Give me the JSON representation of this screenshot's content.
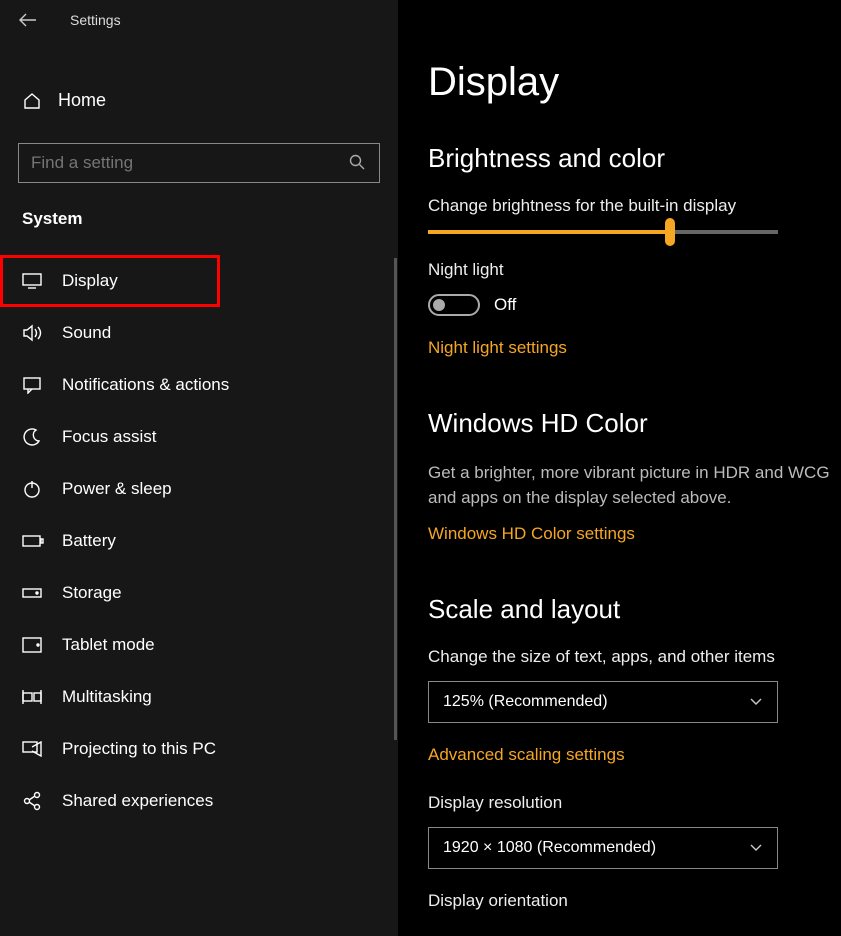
{
  "header": {
    "title": "Settings"
  },
  "home": {
    "label": "Home"
  },
  "search": {
    "placeholder": "Find a setting"
  },
  "section": "System",
  "sidebar": {
    "items": [
      {
        "label": "Display"
      },
      {
        "label": "Sound"
      },
      {
        "label": "Notifications & actions"
      },
      {
        "label": "Focus assist"
      },
      {
        "label": "Power & sleep"
      },
      {
        "label": "Battery"
      },
      {
        "label": "Storage"
      },
      {
        "label": "Tablet mode"
      },
      {
        "label": "Multitasking"
      },
      {
        "label": "Projecting to this PC"
      },
      {
        "label": "Shared experiences"
      }
    ]
  },
  "main": {
    "title": "Display",
    "brightness_head": "Brightness and color",
    "brightness_label": "Change brightness for the built-in display",
    "brightness_value_percent": 69,
    "night_light_label": "Night light",
    "night_light_state": "Off",
    "night_light_link": "Night light settings",
    "hd_head": "Windows HD Color",
    "hd_desc": "Get a brighter, more vibrant picture in HDR and WCG and apps on the display selected above.",
    "hd_link": "Windows HD Color settings",
    "scale_head": "Scale and layout",
    "scale_label": "Change the size of text, apps, and other items",
    "scale_value": "125% (Recommended)",
    "scale_link": "Advanced scaling settings",
    "resolution_label": "Display resolution",
    "resolution_value": "1920 × 1080 (Recommended)",
    "orientation_label": "Display orientation"
  }
}
